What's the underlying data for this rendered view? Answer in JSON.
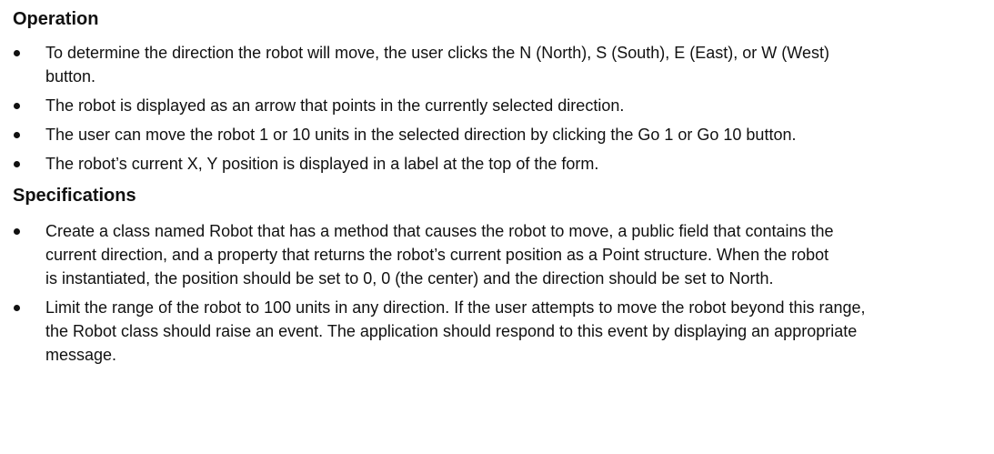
{
  "sections": [
    {
      "heading": "Operation",
      "items": [
        "To determine the direction the robot will move, the user clicks the N (North), S (South), E (East), or W (West) button.",
        "The robot is displayed as an arrow that points in the currently selected direction.",
        "The user can move the robot 1 or 10 units in the selected direction by clicking the Go 1 or Go 10 button.",
        "The robot’s current X, Y position is displayed in a label at the top of the form."
      ]
    },
    {
      "heading": "Specifications",
      "items": [
        "Create a class named Robot that has a method that causes the robot to move, a public field that contains the current direction, and a property that returns the robot’s current position as a Point structure. When the robot is instantiated, the position should be set to 0, 0 (the center) and the direction should be set to North.",
        "Limit the range of the robot to 100 units in any direction. If the user attempts to move the robot beyond this range, the Robot class should raise an event. The application should respond to this event by displaying an appropriate message."
      ]
    }
  ]
}
